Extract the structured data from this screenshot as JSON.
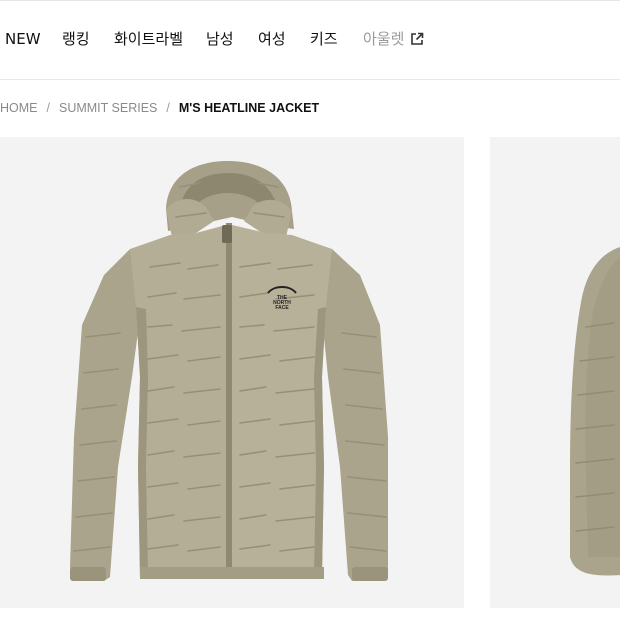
{
  "nav": {
    "items": [
      {
        "label": "NEW"
      },
      {
        "label": "랭킹"
      },
      {
        "label": "화이트라벨"
      },
      {
        "label": "남성"
      },
      {
        "label": "여성"
      },
      {
        "label": "키즈"
      },
      {
        "label": "아울렛",
        "icon": "external-link-icon"
      }
    ]
  },
  "breadcrumb": {
    "home": "HOME",
    "series": "SUMMIT SERIES",
    "current": "M'S HEATLINE JACKET"
  },
  "product": {
    "logo_text": [
      "THE",
      "NORTH",
      "FACE"
    ],
    "colors": {
      "jacket": "#b4ae96",
      "jacket_shadow": "#9a937b",
      "panel_bg": "#f3f3f3"
    }
  }
}
